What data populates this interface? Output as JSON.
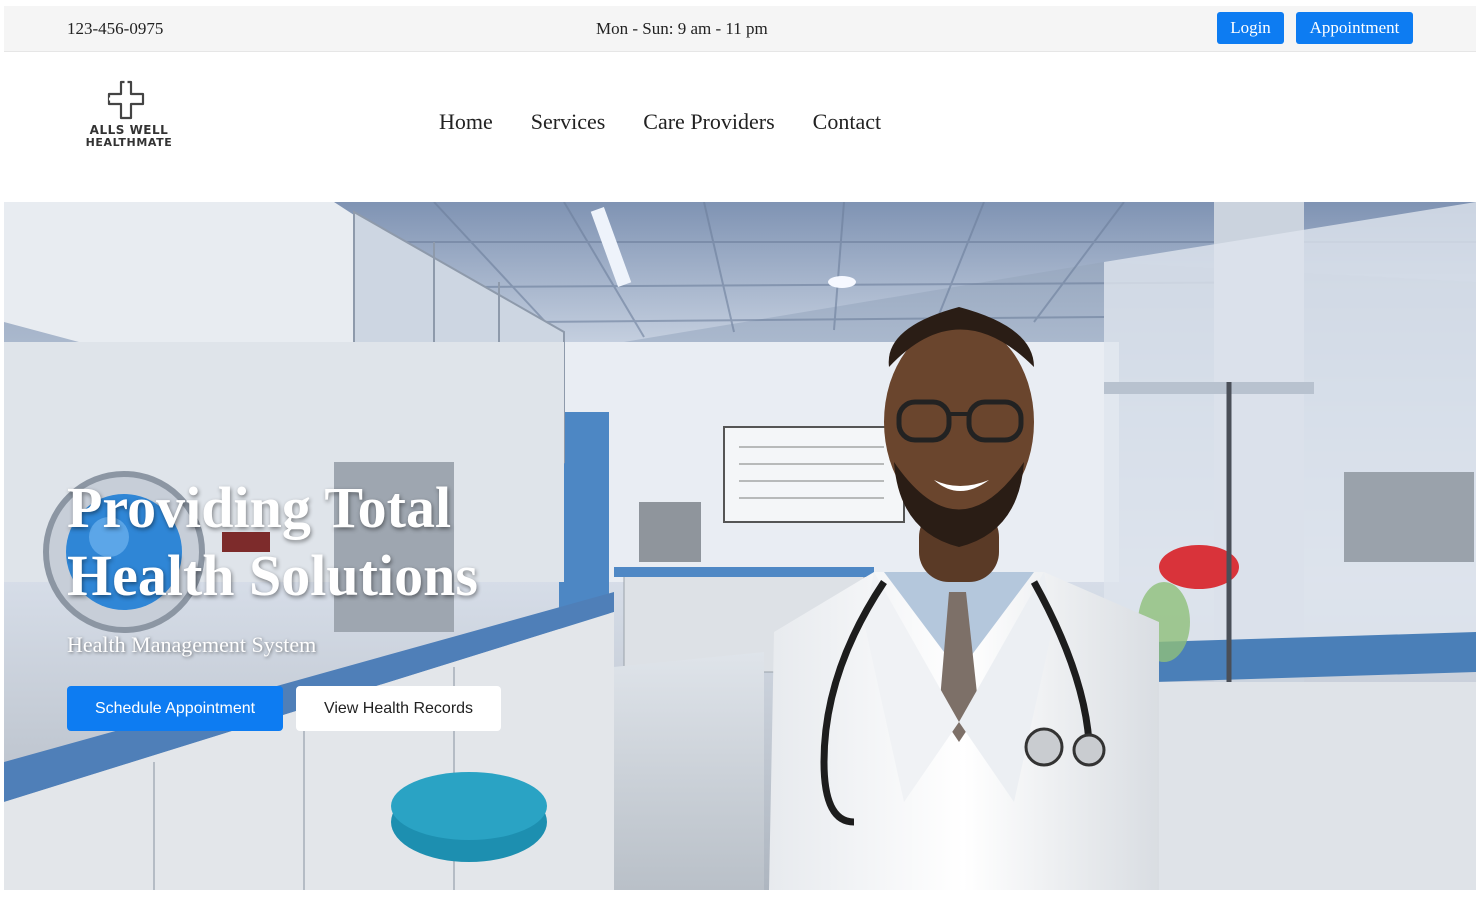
{
  "topbar": {
    "phone": "123-456-0975",
    "hours": "Mon - Sun: 9 am - 11 pm",
    "login_label": "Login",
    "appointment_label": "Appointment"
  },
  "brand": {
    "line1": "ALLS WELL",
    "line2": "HEALTHMATE",
    "icon": "medical-cross-icon"
  },
  "nav": {
    "items": [
      "Home",
      "Services",
      "Care Providers",
      "Contact"
    ]
  },
  "hero": {
    "title": "Providing Total Health Solutions",
    "subtitle": "Health Management System",
    "primary_button": "Schedule Appointment",
    "secondary_button": "View Health Records",
    "image": "doctor-in-laboratory-photo"
  },
  "colors": {
    "accent": "#0d7cf2",
    "topbar_bg": "#f5f5f5",
    "hero_text": "#ffffff"
  }
}
